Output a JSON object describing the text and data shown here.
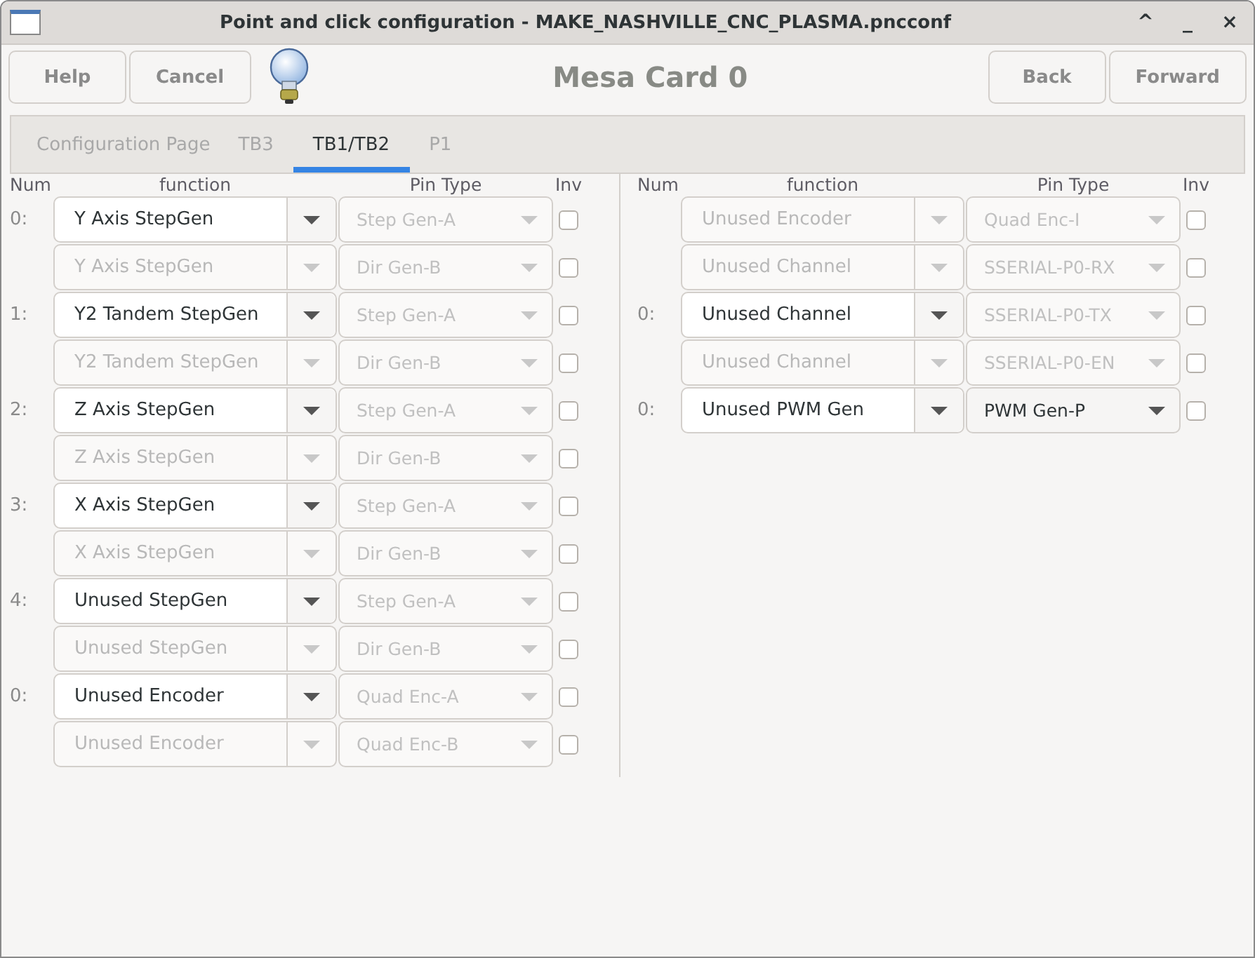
{
  "window": {
    "title": "Point and click configuration - MAKE_NASHVILLE_CNC_PLASMA.pncconf",
    "controls": [
      "^",
      "_",
      "×"
    ]
  },
  "header": {
    "buttons_left": [
      "Help",
      "Cancel"
    ],
    "title": "Mesa Card 0",
    "buttons_right": [
      "Back",
      "Forward"
    ]
  },
  "tabs": [
    {
      "label": "Configuration Page",
      "selected": false
    },
    {
      "label": "TB3",
      "selected": false
    },
    {
      "label": "TB1/TB2",
      "selected": true
    },
    {
      "label": "P1",
      "selected": false
    }
  ],
  "panels": [
    {
      "columns": [
        "Num",
        "function",
        "Pin Type",
        "Inv"
      ],
      "rows": [
        {
          "num": "0:",
          "function": "Y Axis StepGen",
          "function_disabled": false,
          "pin_type": "Step Gen-A",
          "pin_disabled": true,
          "inv": false
        },
        {
          "function": "Y Axis StepGen",
          "function_disabled": true,
          "pin_type": "Dir Gen-B",
          "pin_disabled": true,
          "inv": false
        },
        {
          "num": "1:",
          "function": "Y2 Tandem StepGen",
          "function_disabled": false,
          "pin_type": "Step Gen-A",
          "pin_disabled": true,
          "inv": false
        },
        {
          "function": "Y2 Tandem StepGen",
          "function_disabled": true,
          "pin_type": "Dir Gen-B",
          "pin_disabled": true,
          "inv": false
        },
        {
          "num": "2:",
          "function": "Z Axis StepGen",
          "function_disabled": false,
          "pin_type": "Step Gen-A",
          "pin_disabled": true,
          "inv": false
        },
        {
          "function": "Z Axis StepGen",
          "function_disabled": true,
          "pin_type": "Dir Gen-B",
          "pin_disabled": true,
          "inv": false
        },
        {
          "num": "3:",
          "function": "X Axis StepGen",
          "function_disabled": false,
          "pin_type": "Step Gen-A",
          "pin_disabled": true,
          "inv": false
        },
        {
          "function": "X Axis StepGen",
          "function_disabled": true,
          "pin_type": "Dir Gen-B",
          "pin_disabled": true,
          "inv": false
        },
        {
          "num": "4:",
          "function": "Unused StepGen",
          "function_disabled": false,
          "pin_type": "Step Gen-A",
          "pin_disabled": true,
          "inv": false
        },
        {
          "function": "Unused StepGen",
          "function_disabled": true,
          "pin_type": "Dir Gen-B",
          "pin_disabled": true,
          "inv": false
        },
        {
          "num": "0:",
          "function": "Unused Encoder",
          "function_disabled": false,
          "pin_type": "Quad Enc-A",
          "pin_disabled": true,
          "inv": false
        },
        {
          "function": "Unused Encoder",
          "function_disabled": true,
          "pin_type": "Quad Enc-B",
          "pin_disabled": true,
          "inv": false
        }
      ]
    },
    {
      "columns": [
        "Num",
        "function",
        "Pin Type",
        "Inv"
      ],
      "rows": [
        {
          "function": "Unused Encoder",
          "function_disabled": true,
          "pin_type": "Quad Enc-I",
          "pin_disabled": true,
          "inv": false
        },
        {
          "function": "Unused Channel",
          "function_disabled": true,
          "pin_type": "SSERIAL-P0-RX",
          "pin_disabled": true,
          "inv": false
        },
        {
          "num": "0:",
          "function": "Unused Channel",
          "function_disabled": false,
          "pin_type": "SSERIAL-P0-TX",
          "pin_disabled": true,
          "inv": false
        },
        {
          "function": "Unused Channel",
          "function_disabled": true,
          "pin_type": "SSERIAL-P0-EN",
          "pin_disabled": true,
          "inv": false
        },
        {
          "num": "0:",
          "function": "Unused PWM Gen",
          "function_disabled": false,
          "pin_type": "PWM Gen-P",
          "pin_disabled": false,
          "inv": false
        }
      ]
    }
  ]
}
